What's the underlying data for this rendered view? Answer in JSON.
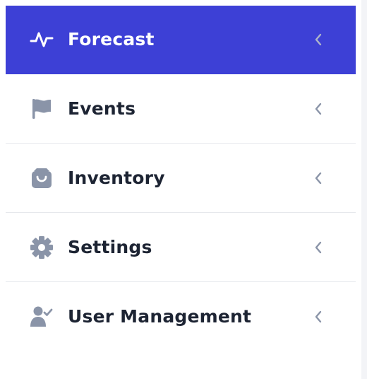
{
  "sidebar": {
    "items": [
      {
        "label": "Forecast",
        "icon": "activity-wave-icon",
        "active": true
      },
      {
        "label": "Events",
        "icon": "flag-icon",
        "active": false
      },
      {
        "label": "Inventory",
        "icon": "shopping-bag-icon",
        "active": false
      },
      {
        "label": "Settings",
        "icon": "gear-icon",
        "active": false
      },
      {
        "label": "User Management",
        "icon": "user-check-icon",
        "active": false
      }
    ]
  },
  "colors": {
    "active_background": "#3d40d6",
    "active_text": "#ffffff",
    "text": "#1d2433",
    "icon": "#8a94a8",
    "chevron": "#8a94a8",
    "divider": "#e6e8ec"
  }
}
